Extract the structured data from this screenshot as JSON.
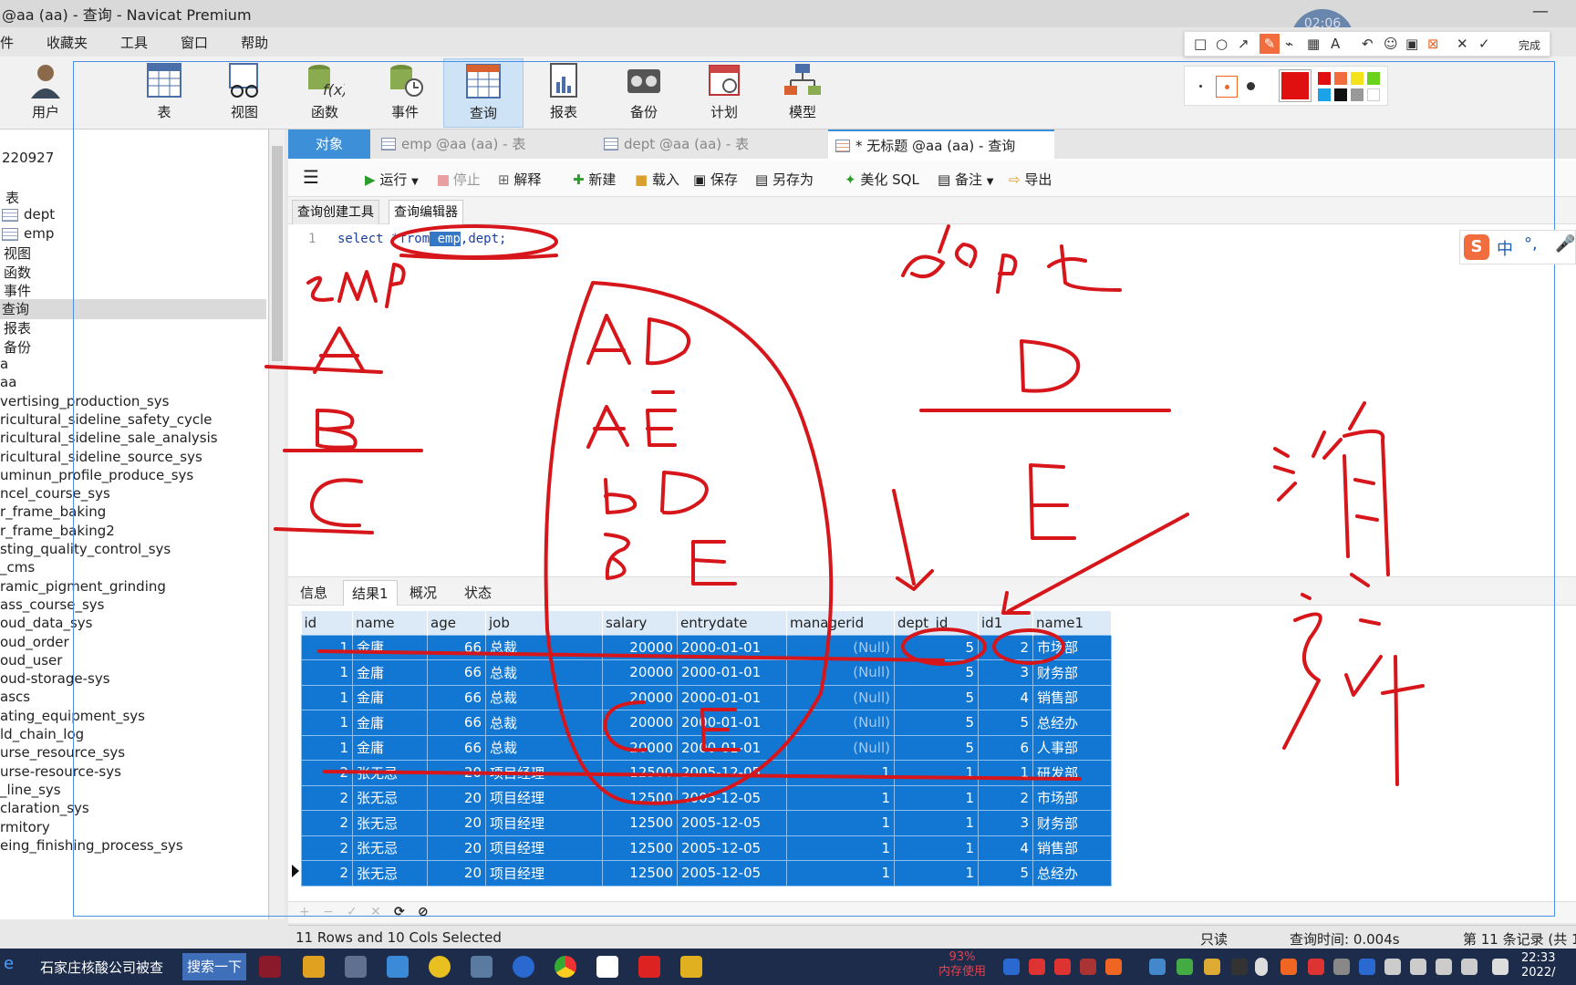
{
  "window": {
    "title": "@aa (aa) - 查询 - Navicat Premium",
    "minimize_glyph": "—"
  },
  "recorder_timer": "02:06",
  "menu": [
    "件",
    "收藏夹",
    "工具",
    "窗口",
    "帮助"
  ],
  "toolbar": {
    "user_label": "用户",
    "tools": [
      {
        "label": "表",
        "icon": "table-icon"
      },
      {
        "label": "视图",
        "icon": "view-icon"
      },
      {
        "label": "函数",
        "icon": "function-icon"
      },
      {
        "label": "事件",
        "icon": "event-icon"
      },
      {
        "label": "查询",
        "icon": "query-icon",
        "active": true
      },
      {
        "label": "报表",
        "icon": "report-icon"
      },
      {
        "label": "备份",
        "icon": "backup-icon"
      },
      {
        "label": "计划",
        "icon": "schedule-icon"
      },
      {
        "label": "模型",
        "icon": "model-icon"
      }
    ]
  },
  "sidebar": {
    "items": [
      "220927",
      "表",
      "dept",
      "emp",
      "视图",
      "函数",
      "事件",
      "查询",
      "报表",
      "备份",
      "a",
      "aa",
      "vertising_production_sys",
      "ricultural_sideline_safety_cycle",
      "ricultural_sideline_sale_analysis",
      "ricultural_sideline_source_sys",
      "uminun_profile_produce_sys",
      "ncel_course_sys",
      "r_frame_baking",
      "r_frame_baking2",
      "sting_quality_control_sys",
      "_cms",
      "ramic_pigment_grinding",
      "ass_course_sys",
      "oud_data_sys",
      "oud_order",
      "oud_user",
      "oud-storage-sys",
      "ascs",
      "ating_equipment_sys",
      "ld_chain_log",
      "urse_resource_sys",
      "urse-resource-sys",
      "_line_sys",
      "claration_sys",
      "rmitory",
      "eing_finishing_process_sys"
    ],
    "selected": "查询"
  },
  "object_tabs": {
    "objects": "对象",
    "tab1": "emp @aa (aa) - 表",
    "tab2": "dept @aa (aa) - 表",
    "tab3": "* 无标题 @aa (aa) - 查询"
  },
  "query_toolbar": {
    "menu_glyph": "☰",
    "run": "运行",
    "stop": "停止",
    "explain": "解释",
    "new": "新建",
    "load": "载入",
    "save": "保存",
    "save_as": "另存为",
    "beautify": "美化 SQL",
    "comment": "备注",
    "export": "导出"
  },
  "editor_tabs": {
    "builder": "查询创建工具",
    "editor": "查询编辑器"
  },
  "editor": {
    "line_number": "1",
    "code_before": "select *",
    "code_from": "from",
    "code_space": " ",
    "code_emp": "emp",
    "code_after": ",dept;"
  },
  "result_tabs": [
    "信息",
    "结果1",
    "概况",
    "状态"
  ],
  "result_grid": {
    "columns": [
      "id",
      "name",
      "age",
      "job",
      "salary",
      "entrydate",
      "managerid",
      "dept_id",
      "id1",
      "name1"
    ],
    "rows": [
      [
        "1",
        "金庸",
        "66",
        "总裁",
        "20000",
        "2000-01-01",
        "(Null)",
        "5",
        "2",
        "市场部"
      ],
      [
        "1",
        "金庸",
        "66",
        "总裁",
        "20000",
        "2000-01-01",
        "(Null)",
        "5",
        "3",
        "财务部"
      ],
      [
        "1",
        "金庸",
        "66",
        "总裁",
        "20000",
        "2000-01-01",
        "(Null)",
        "5",
        "4",
        "销售部"
      ],
      [
        "1",
        "金庸",
        "66",
        "总裁",
        "20000",
        "2000-01-01",
        "(Null)",
        "5",
        "5",
        "总经办"
      ],
      [
        "1",
        "金庸",
        "66",
        "总裁",
        "20000",
        "2000-01-01",
        "(Null)",
        "5",
        "6",
        "人事部"
      ],
      [
        "2",
        "张无忌",
        "20",
        "项目经理",
        "12500",
        "2005-12-05",
        "1",
        "1",
        "1",
        "研发部"
      ],
      [
        "2",
        "张无忌",
        "20",
        "项目经理",
        "12500",
        "2005-12-05",
        "1",
        "1",
        "2",
        "市场部"
      ],
      [
        "2",
        "张无忌",
        "20",
        "项目经理",
        "12500",
        "2005-12-05",
        "1",
        "1",
        "3",
        "财务部"
      ],
      [
        "2",
        "张无忌",
        "20",
        "项目经理",
        "12500",
        "2005-12-05",
        "1",
        "1",
        "4",
        "销售部"
      ],
      [
        "2",
        "张无忌",
        "20",
        "项目经理",
        "12500",
        "2005-12-05",
        "1",
        "1",
        "5",
        "总经办"
      ]
    ]
  },
  "grid_bar": [
    "+",
    "−",
    "✓",
    "✕",
    "⟳",
    "⊘"
  ],
  "status": {
    "selection": "11 Rows and 10 Cols Selected",
    "readonly": "只读",
    "query_time": "查询时间: 0.004s",
    "record": "第 11 条记录 (共 1"
  },
  "taskbar": {
    "search_text": "石家庄核酸公司被查",
    "search_button": "搜索一下",
    "mem_percent": "93%",
    "mem_label": "内存使用",
    "time": "22:33",
    "date": "2022/"
  },
  "draw_toolbar": {
    "finish": "完成"
  },
  "ime": {
    "mode": "中"
  },
  "colors": {
    "accent": "#3d8fd8",
    "selection": "#1277d3",
    "ink": "#d6161a",
    "taskbar": "#1c2c4a"
  }
}
